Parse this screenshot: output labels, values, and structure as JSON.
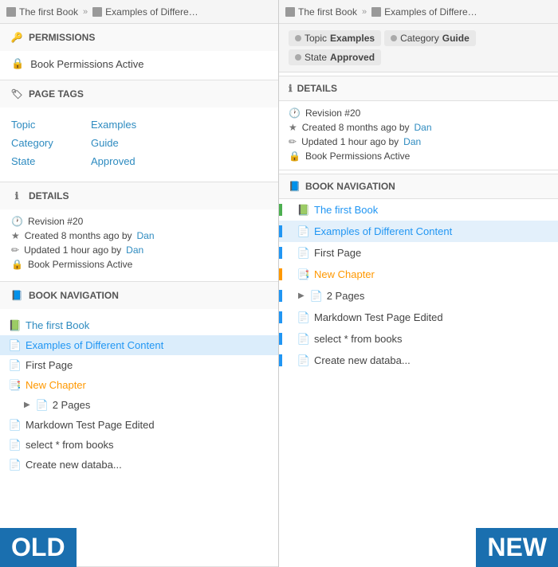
{
  "left": {
    "breadcrumb": {
      "book": "The first Book",
      "separator": "»",
      "page": "Examples of Different ..."
    },
    "permissions": {
      "header": "PERMISSIONS",
      "item": "Book Permissions Active"
    },
    "pageTags": {
      "header": "PAGE TAGS",
      "tags": [
        {
          "key": "Topic",
          "value": "Examples"
        },
        {
          "key": "Category",
          "value": "Guide"
        },
        {
          "key": "State",
          "value": "Approved"
        }
      ]
    },
    "details": {
      "header": "DETAILS",
      "revision": "Revision #20",
      "created": "Created 8 months ago by",
      "createdBy": "Dan",
      "updated": "Updated 1 hour ago by",
      "updatedBy": "Dan",
      "permissions": "Book Permissions Active"
    },
    "bookNav": {
      "header": "BOOK NAVIGATION",
      "items": [
        {
          "text": "The first Book",
          "type": "book"
        },
        {
          "text": "Examples of Different Content",
          "type": "page",
          "active": true
        },
        {
          "text": "First Page",
          "type": "page"
        },
        {
          "text": "New Chapter",
          "type": "chapter"
        },
        {
          "text": "2 Pages",
          "type": "sub"
        },
        {
          "text": "Markdown Test Page Edited",
          "type": "page"
        },
        {
          "text": "select * from books",
          "type": "page"
        },
        {
          "text": "Create new databa...",
          "type": "page"
        }
      ]
    }
  },
  "right": {
    "breadcrumb": {
      "book": "The first Book",
      "separator": "»",
      "page": "Examples of Different ..."
    },
    "tags": [
      {
        "label": "Topic",
        "value": "Examples"
      },
      {
        "label": "Category",
        "value": "Guide"
      },
      {
        "label": "State",
        "value": "Approved"
      }
    ],
    "details": {
      "header": "DETAILS",
      "revision": "Revision #20",
      "created": "Created 8 months ago by",
      "createdBy": "Dan",
      "updated": "Updated 1 hour ago by",
      "updatedBy": "Dan",
      "permissions": "Book Permissions Active"
    },
    "bookNav": {
      "header": "BOOK NAVIGATION",
      "items": [
        {
          "text": "The first Book",
          "type": "book",
          "border": "green"
        },
        {
          "text": "Examples of Different Content",
          "type": "page",
          "border": "blue",
          "active": true
        },
        {
          "text": "First Page",
          "type": "page",
          "border": "blue"
        },
        {
          "text": "New Chapter",
          "type": "chapter",
          "border": "orange"
        },
        {
          "text": "2 Pages",
          "type": "sub",
          "border": "blue"
        },
        {
          "text": "Markdown Test Page Edited",
          "type": "page",
          "border": "blue"
        },
        {
          "text": "select * from books",
          "type": "page",
          "border": "blue"
        },
        {
          "text": "Create new databa...",
          "type": "page",
          "border": "blue"
        }
      ]
    }
  },
  "badges": {
    "old": "OLD",
    "new": "NEW"
  }
}
